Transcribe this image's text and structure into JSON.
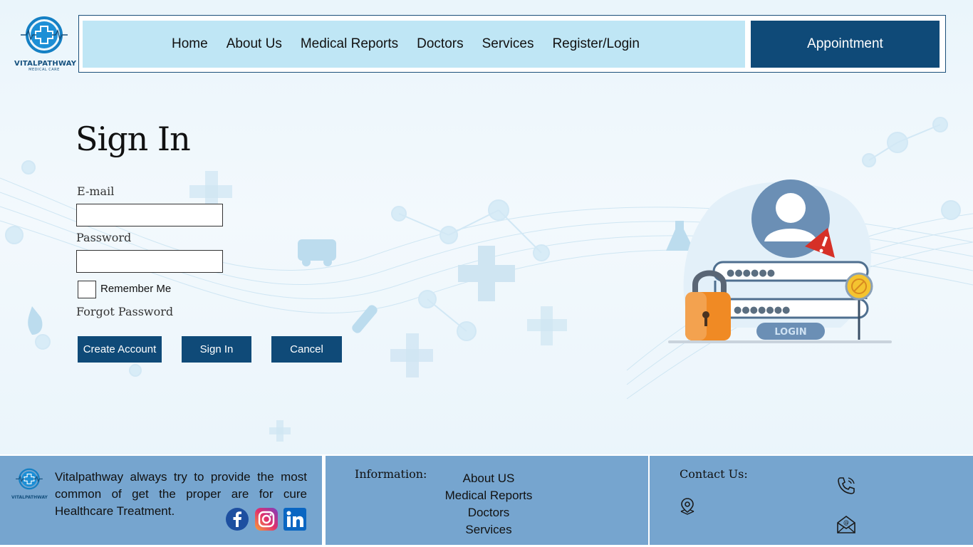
{
  "brand": {
    "name": "VITALPATHWAY",
    "tagline": "MEDICAL CARE"
  },
  "nav": {
    "items": [
      {
        "label": "Home"
      },
      {
        "label": "About Us"
      },
      {
        "label": "Medical Reports"
      },
      {
        "label": "Doctors"
      },
      {
        "label": "Services"
      },
      {
        "label": "Register/Login"
      }
    ],
    "appointment_label": "Appointment"
  },
  "signin": {
    "title": "Sign In",
    "email_label": "E-mail",
    "email_value": "",
    "password_label": "Password",
    "password_value": "",
    "remember_label": "Remember Me",
    "remember_checked": false,
    "forgot_label": "Forgot Password",
    "create_account_label": "Create Account",
    "signin_label": "Sign In",
    "cancel_label": "Cancel"
  },
  "illustration": {
    "login_label": "LOGIN",
    "username_mask": "●●●●●●",
    "password_mask": "●●●●●●●"
  },
  "footer": {
    "about_text": "Vitalpathway always try to provide the most common of get the proper are for cure Healthcare Treatment.",
    "information_heading": "Information:",
    "information_links": [
      {
        "label": "About US"
      },
      {
        "label": "Medical Reports"
      },
      {
        "label": "Doctors"
      },
      {
        "label": "Services"
      }
    ],
    "contact_heading": "Contact Us:",
    "social": [
      "facebook-icon",
      "instagram-icon",
      "linkedin-icon"
    ],
    "contact_icons": [
      "phone-icon",
      "location-pin-icon",
      "email-icon"
    ]
  },
  "colors": {
    "primary": "#0f4a78",
    "nav_bg": "#bfe6f5",
    "footer_bg": "#76a5cf",
    "accent_orange": "#f08a24",
    "alert_red": "#d63027"
  }
}
